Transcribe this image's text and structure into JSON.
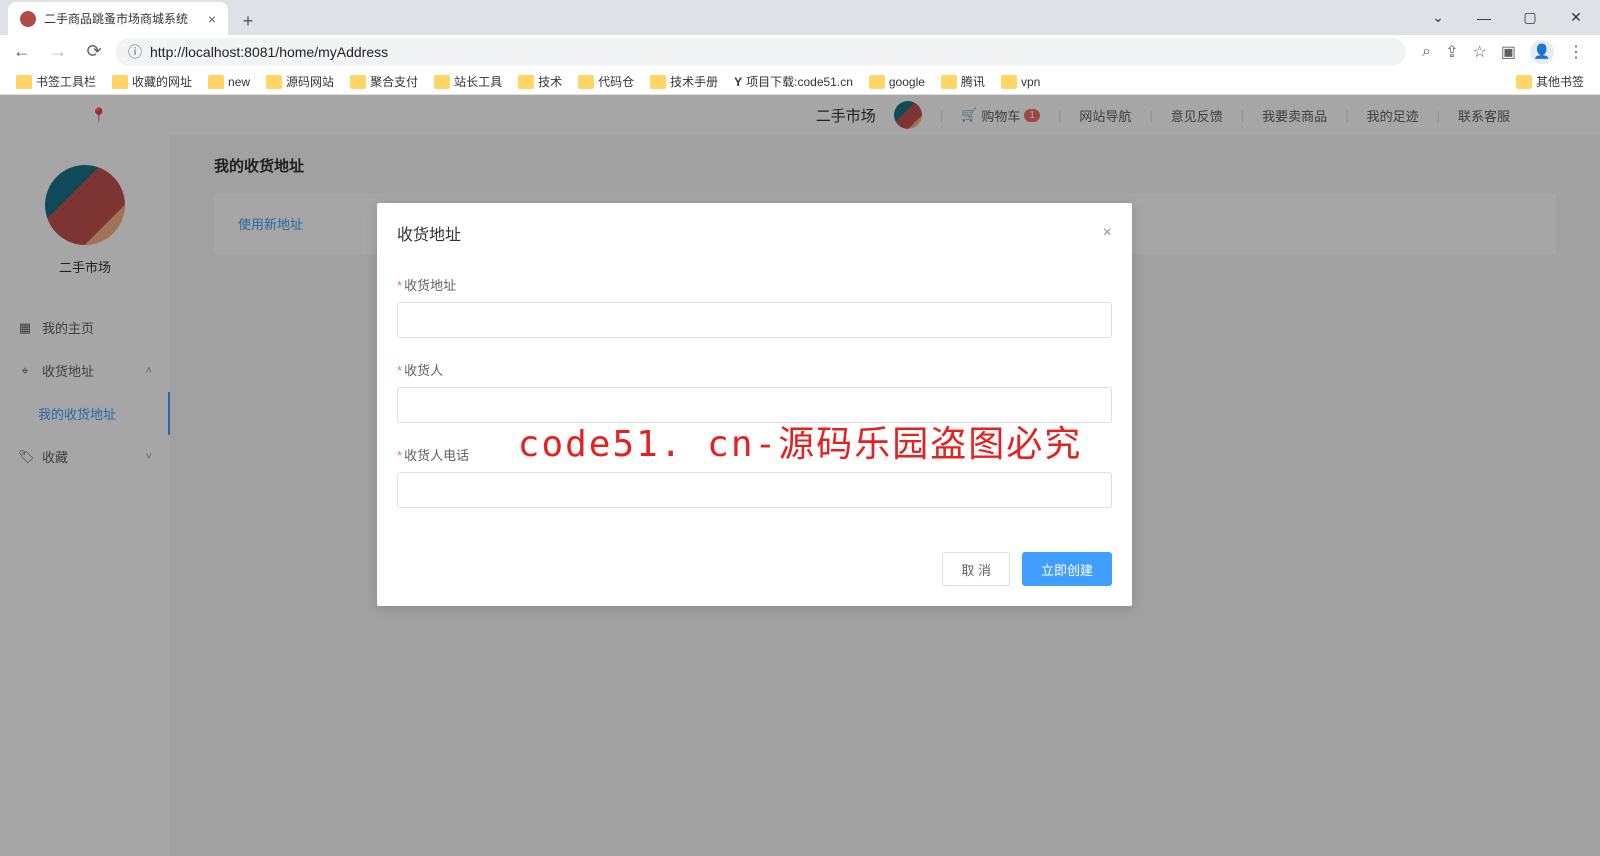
{
  "browser": {
    "tab_title": "二手商品跳蚤市场商城系统",
    "url": "http://localhost:8081/home/myAddress",
    "url_host": "localhost",
    "new_tab": "+",
    "bookmarks": [
      "书签工具栏",
      "收藏的网址",
      "new",
      "源码网站",
      "聚合支付",
      "站长工具",
      "技术",
      "代码仓",
      "技术手册",
      "项目下载:code51.cn",
      "google",
      "腾讯",
      "vpn"
    ],
    "bookmarks_right": "其他书签"
  },
  "header": {
    "brand": "二手市场",
    "cart": "购物车",
    "cart_count": "1",
    "nav_site": "网站导航",
    "feedback": "意见反馈",
    "sell": "我要卖商品",
    "footprint": "我的足迹",
    "service": "联系客服"
  },
  "sidebar": {
    "username": "二手市场",
    "menu_home": "我的主页",
    "menu_address": "收货地址",
    "menu_address_sub": "我的收货地址",
    "menu_fav": "收藏"
  },
  "content": {
    "page_title": "我的收货地址",
    "new_address_link": "使用新地址"
  },
  "modal": {
    "title": "收货地址",
    "field_address": "收货地址",
    "field_receiver": "收货人",
    "field_phone": "收货人电话",
    "btn_cancel": "取 消",
    "btn_confirm": "立即创建"
  },
  "watermark": "code51. cn-源码乐园盗图必究"
}
